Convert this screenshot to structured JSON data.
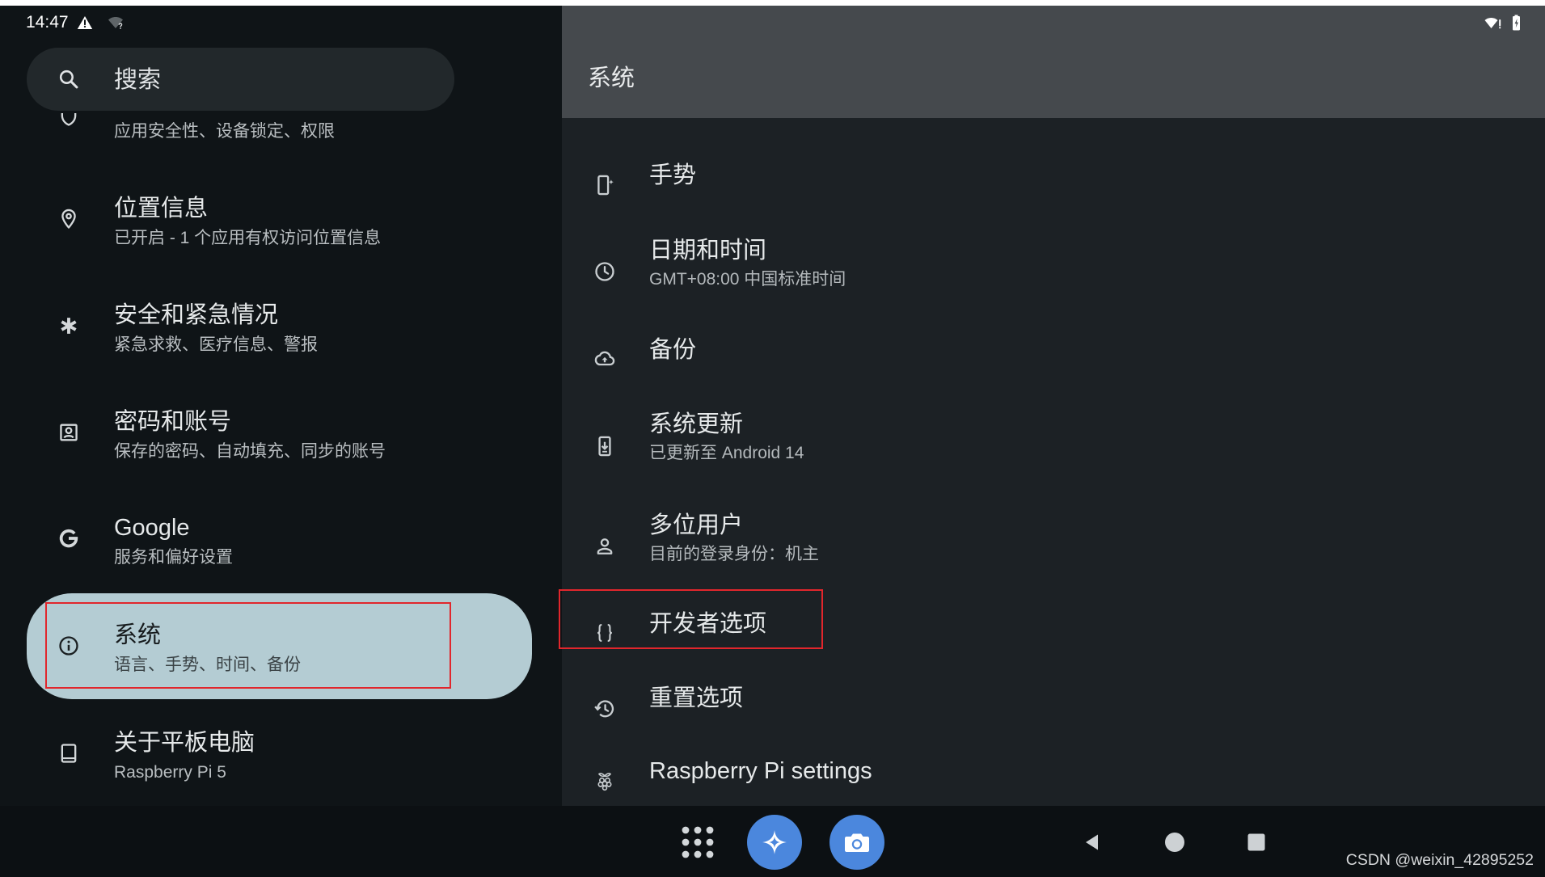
{
  "status_bar": {
    "time": "14:47",
    "left_icons": [
      "warning-icon",
      "wifi-unknown-icon"
    ],
    "right_icons": [
      "wifi-alert-icon",
      "battery-charging-icon"
    ]
  },
  "search": {
    "label": "搜索",
    "icon": "search-icon"
  },
  "left_list": {
    "partial_item": {
      "subtitle": "应用安全性、设备锁定、权限",
      "icon": "shield-icon"
    },
    "items": [
      {
        "title": "位置信息",
        "subtitle": "已开启 - 1 个应用有权访问位置信息",
        "icon": "location-pin-icon"
      },
      {
        "title": "安全和紧急情况",
        "subtitle": "紧急求救、医疗信息、警报",
        "icon": "asterisk-icon"
      },
      {
        "title": "密码和账号",
        "subtitle": "保存的密码、自动填充、同步的账号",
        "icon": "account-box-icon"
      },
      {
        "title": "Google",
        "subtitle": "服务和偏好设置",
        "icon": "google-icon"
      },
      {
        "title": "系统",
        "subtitle": "语言、手势、时间、备份",
        "icon": "info-icon",
        "selected": true
      },
      {
        "title": "关于平板电脑",
        "subtitle": "Raspberry Pi 5",
        "icon": "tablet-icon"
      }
    ]
  },
  "detail": {
    "title": "系统",
    "items": [
      {
        "title": "手势",
        "icon": "gestures-icon"
      },
      {
        "title": "日期和时间",
        "subtitle": "GMT+08:00 中国标准时间",
        "icon": "clock-icon"
      },
      {
        "title": "备份",
        "icon": "cloud-upload-icon"
      },
      {
        "title": "系统更新",
        "subtitle": "已更新至 Android 14",
        "icon": "system-update-icon"
      },
      {
        "title": "多位用户",
        "subtitle": "目前的登录身份：机主",
        "icon": "person-icon"
      },
      {
        "title": "开发者选项",
        "icon": "braces-icon",
        "highlighted": true
      },
      {
        "title": "重置选项",
        "icon": "history-icon"
      },
      {
        "title": "Raspberry Pi settings",
        "icon": "raspberry-icon"
      }
    ]
  },
  "nav_bar": {
    "icons": [
      "apps-grid-icon",
      "assistant-sparkle-icon",
      "camera-icon",
      "back-icon",
      "home-icon",
      "recents-icon"
    ]
  },
  "watermark": "CSDN @weixin_42895252",
  "colors": {
    "top_strip": "#ffffff",
    "left_bg": "#0f1417",
    "search_bg": "#22282b",
    "selected_bg": "#b4ccd3",
    "right_bg": "#1c2125",
    "header_bg": "#45494d",
    "nav_bg": "#0c1013",
    "annotation_red": "#e1262c",
    "fab_blue": "#4b87dd"
  }
}
